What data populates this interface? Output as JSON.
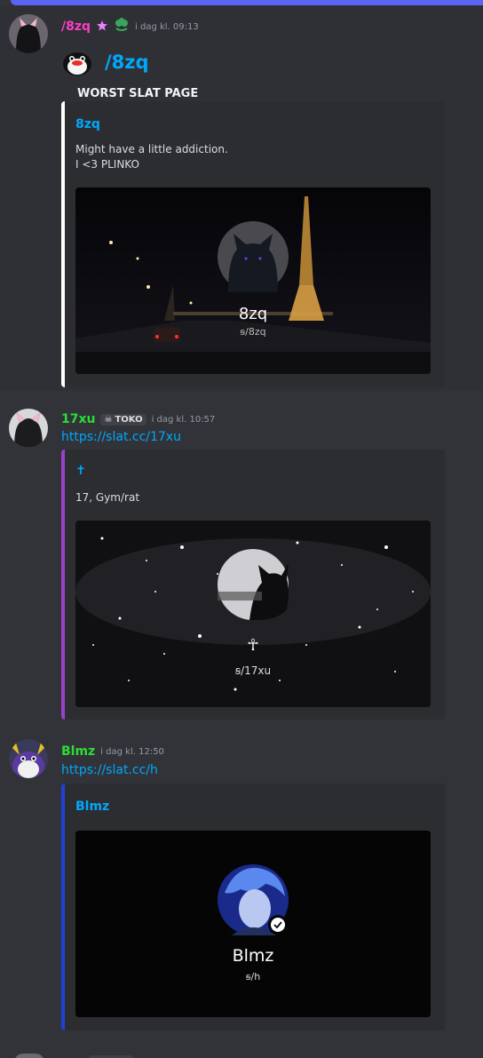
{
  "messages": [
    {
      "username": "/8zq",
      "username_color": "#ff3cc8",
      "timestamp": "i dag kl. 09:13",
      "content_title": "/8zq",
      "content_heading": "WORST SLAT PAGE",
      "embed": {
        "border_color": "#ffffff",
        "title": "8zq",
        "description_lines": [
          "Might have a little addiction.",
          "I <3 PLINKO"
        ],
        "image": {
          "name": "8zq",
          "handle": "ꞩ/8zq"
        }
      }
    },
    {
      "username": "17xu",
      "username_color": "#2bdd36",
      "tag": "TOKO",
      "timestamp": "i dag kl. 10:57",
      "link": "https://slat.cc/17xu",
      "embed": {
        "border_color": "#9b40c9",
        "title": "✝",
        "description_lines": [
          "17, Gym/rat"
        ],
        "image": {
          "name": "☥",
          "handle": "ꞩ/17xu"
        }
      }
    },
    {
      "username": "Blmz",
      "username_color": "#2bdd36",
      "timestamp": "i dag kl. 12:50",
      "link": "https://slat.cc/h",
      "embed": {
        "border_color": "#1e40d8",
        "title": "Blmz",
        "image": {
          "name": "Blmz",
          "handle": "ꞩ/h"
        }
      }
    }
  ]
}
